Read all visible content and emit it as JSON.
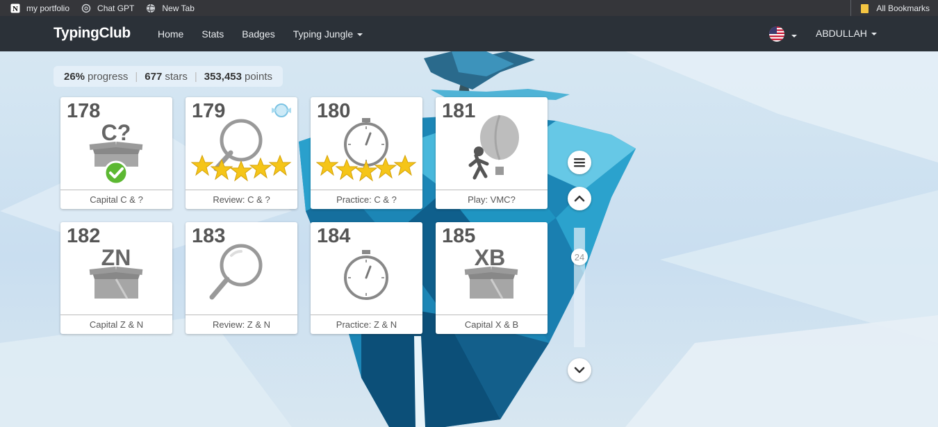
{
  "bookmarks": {
    "items": [
      {
        "label": "my portfolio",
        "icon": "notion-icon"
      },
      {
        "label": "Chat GPT",
        "icon": "chatgpt-icon"
      },
      {
        "label": "New Tab",
        "icon": "globe-icon"
      }
    ],
    "all_label": "All Bookmarks"
  },
  "nav": {
    "brand": "TypingClub",
    "links": [
      "Home",
      "Stats",
      "Badges",
      "Typing Jungle"
    ],
    "user": "ABDULLAH"
  },
  "stats": {
    "progress_value": "26%",
    "progress_label": "progress",
    "stars_value": "677",
    "stars_label": "stars",
    "points_value": "353,453",
    "points_label": "points"
  },
  "lessons": [
    {
      "number": "178",
      "label": "Capital C & ?",
      "type": "box",
      "box_text": "C?",
      "completed": true,
      "stars": 0
    },
    {
      "number": "179",
      "label": "Review: C & ?",
      "type": "review",
      "stars": 5,
      "badge": true
    },
    {
      "number": "180",
      "label": "Practice: C & ?",
      "type": "practice",
      "stars": 5
    },
    {
      "number": "181",
      "label": "Play: VMC?",
      "type": "play",
      "stars": 0
    },
    {
      "number": "182",
      "label": "Capital Z & N",
      "type": "box",
      "box_text": "ZN",
      "completed": false,
      "stars": 0
    },
    {
      "number": "183",
      "label": "Review: Z & N",
      "type": "review",
      "stars": 0
    },
    {
      "number": "184",
      "label": "Practice: Z & N",
      "type": "practice",
      "stars": 0
    },
    {
      "number": "185",
      "label": "Capital X & B",
      "type": "box",
      "box_text": "XB",
      "completed": false,
      "stars": 0
    }
  ],
  "controls": {
    "current_level": "24"
  },
  "colors": {
    "nav_bg": "#2b3138",
    "star": "#f5c518",
    "check": "#5cb832",
    "island": "#1e88b8"
  }
}
